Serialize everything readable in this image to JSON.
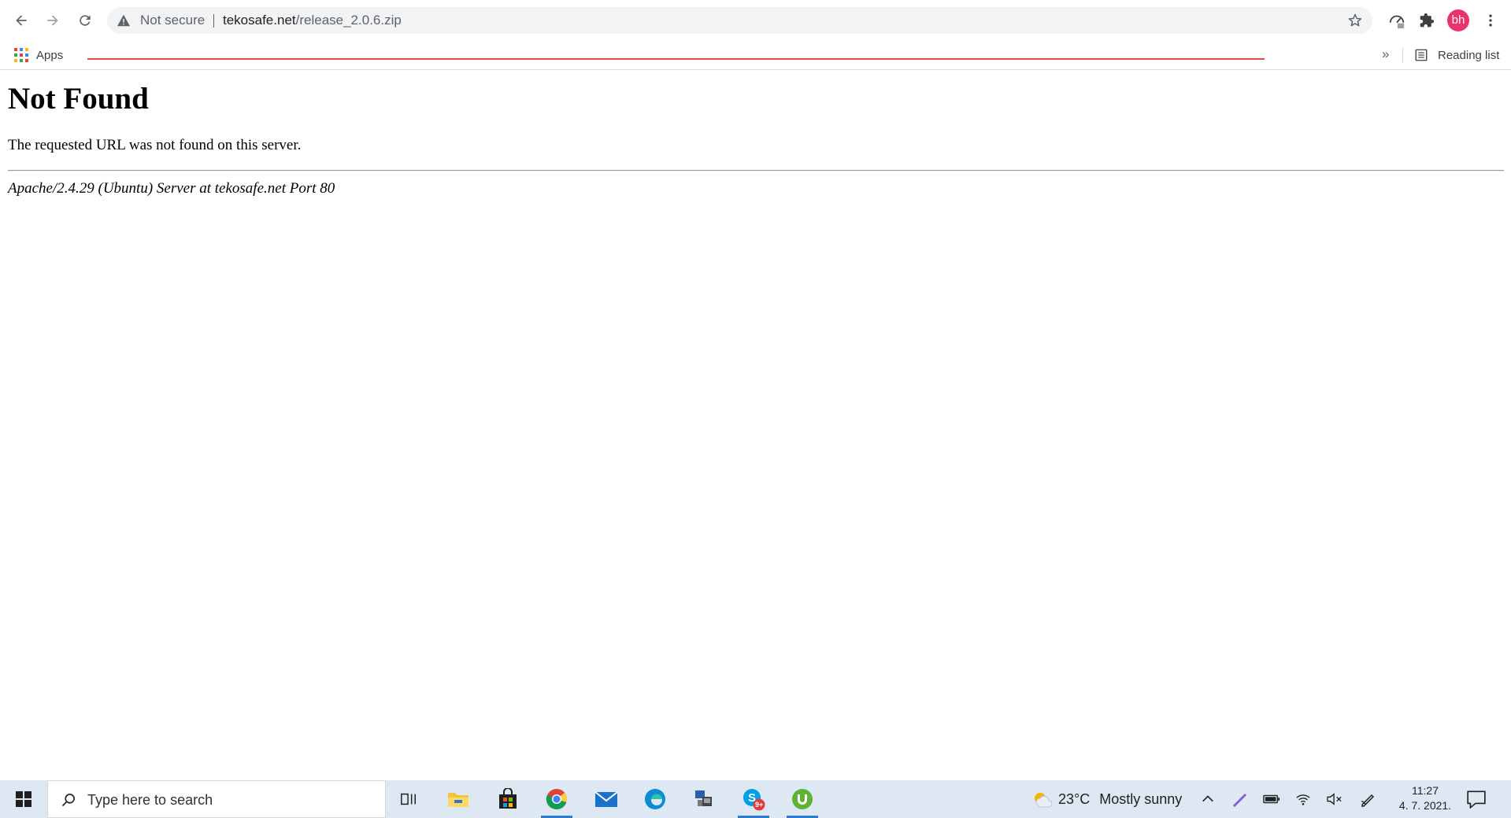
{
  "browser": {
    "security_label": "Not secure",
    "url_host": "tekosafe.net",
    "url_path": "/release_2.0.6.zip",
    "profile_initials": "bh",
    "bookmarks": {
      "apps_label": "Apps",
      "overflow_label": "»",
      "reading_list_label": "Reading list"
    }
  },
  "page": {
    "heading": "Not Found",
    "message": "The requested URL was not found on this server.",
    "server_signature": "Apache/2.4.29 (Ubuntu) Server at tekosafe.net Port 80"
  },
  "taskbar": {
    "search_placeholder": "Type here to search",
    "skype_badge": "9+",
    "weather_temp": "23°C",
    "weather_text": "Mostly sunny",
    "time": "11:27",
    "date": "4. 7. 2021."
  },
  "colors": {
    "avatar": "#e8336b",
    "taskbar_bg": "#dde8f3",
    "active_underline": "#2a7bd6",
    "bookmark_red_line": "#d93025"
  }
}
